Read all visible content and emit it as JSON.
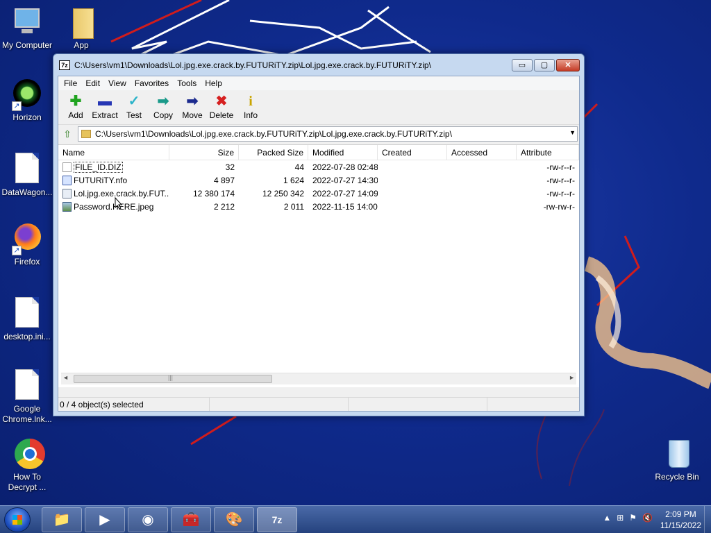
{
  "desktop": {
    "icons": [
      {
        "label": "My Computer"
      },
      {
        "label": "App"
      },
      {
        "label": "Horizon"
      },
      {
        "label": "DataWagon..."
      },
      {
        "label": "Firefox"
      },
      {
        "label": "desktop.ini..."
      },
      {
        "label": "Google Chrome.lnk..."
      },
      {
        "label": "How To Decrypt ..."
      },
      {
        "label": "Recycle Bin"
      }
    ]
  },
  "window": {
    "app_icon": "7z",
    "title": "C:\\Users\\vm1\\Downloads\\Lol.jpg.exe.crack.by.FUTURiTY.zip\\Lol.jpg.exe.crack.by.FUTURiTY.zip\\",
    "controls": {
      "minimize": "▭",
      "maximize": "▢",
      "close": "✕"
    }
  },
  "menu": [
    "File",
    "Edit",
    "View",
    "Favorites",
    "Tools",
    "Help"
  ],
  "toolbar": [
    {
      "label": "Add",
      "glyph": "✚",
      "color": "#1fa31f",
      "icon": "add-icon"
    },
    {
      "label": "Extract",
      "glyph": "▬",
      "color": "#2636b4",
      "icon": "extract-icon"
    },
    {
      "label": "Test",
      "glyph": "✓",
      "color": "#2bb3c9",
      "icon": "test-icon"
    },
    {
      "label": "Copy",
      "glyph": "➡",
      "color": "#1a9a8a",
      "icon": "copy-icon"
    },
    {
      "label": "Move",
      "glyph": "➡",
      "color": "#1b2a8e",
      "icon": "move-icon"
    },
    {
      "label": "Delete",
      "glyph": "✖",
      "color": "#d62020",
      "icon": "delete-icon"
    },
    {
      "label": "Info",
      "glyph": "i",
      "color": "#c9a400",
      "icon": "info-icon"
    }
  ],
  "address": {
    "up_glyph": "⇧",
    "path": "C:\\Users\\vm1\\Downloads\\Lol.jpg.exe.crack.by.FUTURiTY.zip\\Lol.jpg.exe.crack.by.FUTURiTY.zip\\",
    "dropdown_glyph": "▼"
  },
  "columns": [
    "Name",
    "Size",
    "Packed Size",
    "Modified",
    "Created",
    "Accessed",
    "Attribute"
  ],
  "files": [
    {
      "name": "FILE_ID.DIZ",
      "size": "32",
      "packed": "44",
      "modified": "2022-07-28 02:48",
      "created": "",
      "accessed": "",
      "attributes": "-rw-r--r-",
      "type": "text"
    },
    {
      "name": "FUTURiTY.nfo",
      "size": "4 897",
      "packed": "1 624",
      "modified": "2022-07-27 14:30",
      "created": "",
      "accessed": "",
      "attributes": "-rw-r--r-",
      "type": "nfo"
    },
    {
      "name": "Lol.jpg.exe.crack.by.FUT...",
      "size": "12 380 174",
      "packed": "12 250 342",
      "modified": "2022-07-27 14:09",
      "created": "",
      "accessed": "",
      "attributes": "-rw-r--r-",
      "type": "exe"
    },
    {
      "name": "Password.HERE.jpeg",
      "size": "2 212",
      "packed": "2 011",
      "modified": "2022-11-15 14:00",
      "created": "",
      "accessed": "",
      "attributes": "-rw-rw-r-",
      "type": "img"
    }
  ],
  "scroll": {
    "left": "◄",
    "right": "►",
    "grip": "|||"
  },
  "status": {
    "selection": "0 / 4 object(s) selected"
  },
  "taskbar": {
    "buttons": [
      {
        "name": "explorer",
        "glyph": "📁"
      },
      {
        "name": "media-player",
        "glyph": "▶"
      },
      {
        "name": "chrome",
        "glyph": "◉"
      },
      {
        "name": "toolbox",
        "glyph": "🧰"
      },
      {
        "name": "paint",
        "glyph": "🎨"
      },
      {
        "name": "7zip",
        "glyph": "7z"
      }
    ],
    "tray_glyphs": [
      "▲",
      "⊞",
      "⚑",
      "🔇"
    ],
    "time": "2:09 PM",
    "date": "11/15/2022"
  }
}
